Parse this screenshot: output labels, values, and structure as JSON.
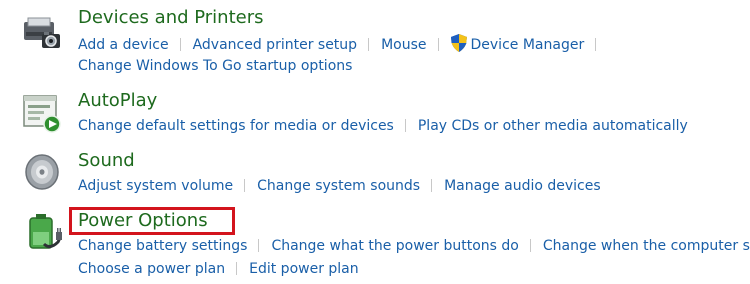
{
  "categories": {
    "devices": {
      "title": "Devices and Printers",
      "row1": [
        "Add a device",
        "Advanced printer setup",
        "Mouse",
        "Device Manager"
      ],
      "row2": [
        "Change Windows To Go startup options"
      ],
      "icon": "printer-camera-icon"
    },
    "autoplay": {
      "title": "AutoPlay",
      "row1": [
        "Change default settings for media or devices",
        "Play CDs or other media automatically"
      ],
      "icon": "autoplay-icon"
    },
    "sound": {
      "title": "Sound",
      "row1": [
        "Adjust system volume",
        "Change system sounds",
        "Manage audio devices"
      ],
      "icon": "speaker-icon"
    },
    "power": {
      "title": "Power Options",
      "row1": [
        "Change battery settings",
        "Change what the power buttons do",
        "Change when the computer sleeps"
      ],
      "row2": [
        "Choose a power plan",
        "Edit power plan"
      ],
      "icon": "battery-plug-icon"
    }
  },
  "colors": {
    "title": "#1e6a1e",
    "link": "#1a5fa8",
    "highlight": "#d3141d"
  },
  "icons": {
    "device_manager": "uac-shield-icon"
  }
}
